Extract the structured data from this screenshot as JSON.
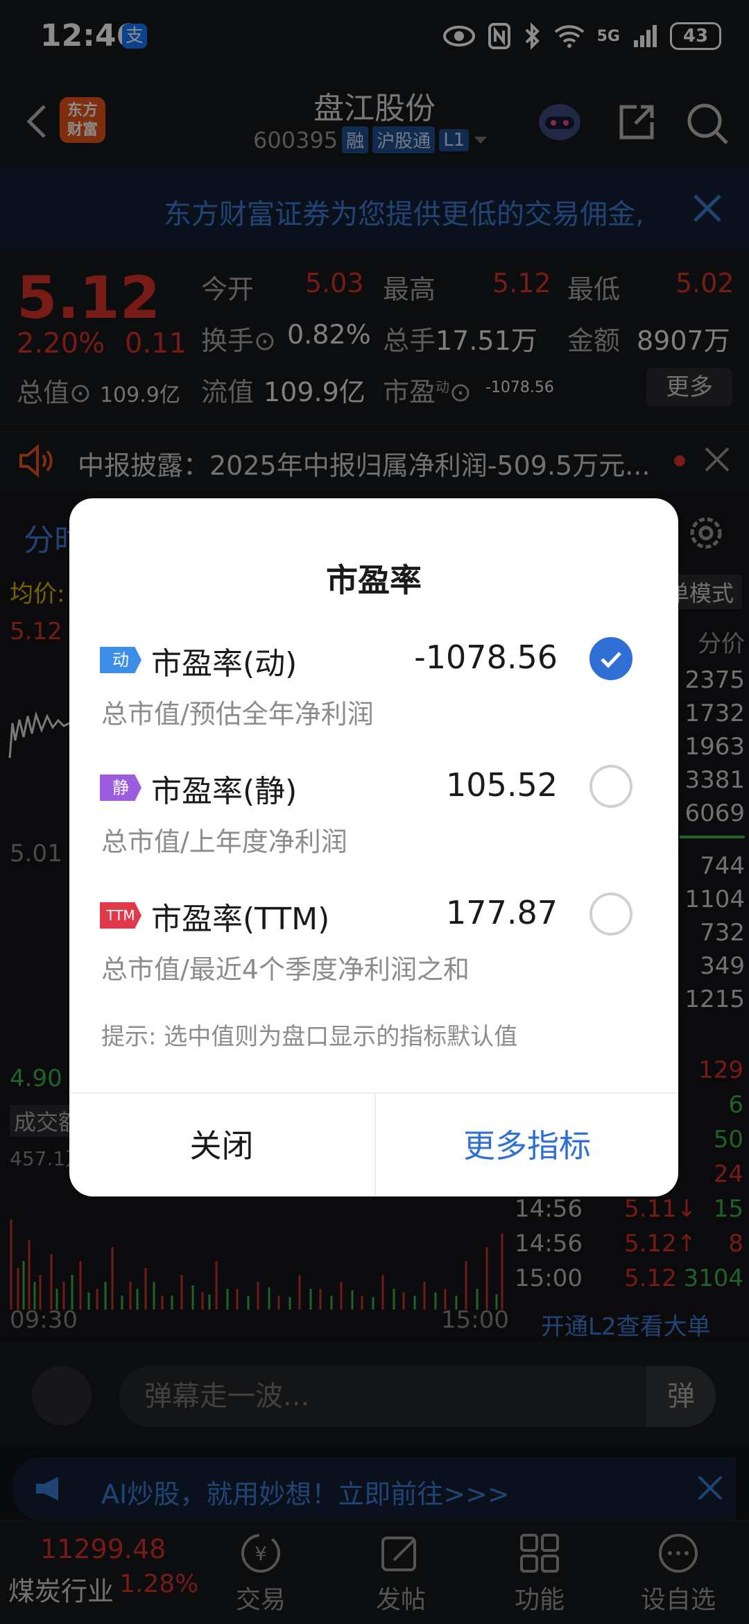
{
  "status_bar": {
    "time": "12:46",
    "alipay_icon": "支",
    "network": "5G",
    "battery": "43"
  },
  "header": {
    "stock_name": "盘江股份",
    "stock_code": "600395",
    "tags": [
      "融",
      "沪股通",
      "L1"
    ],
    "brand_logo": "东方\n财富"
  },
  "banner": {
    "text": "东方财富证券为您提供更低的交易佣金,"
  },
  "quote": {
    "price": "5.12",
    "change_pct": "2.20%",
    "change": "0.11",
    "total_value_label": "总值",
    "total_value": "109.9亿",
    "open_label": "今开",
    "open": "5.03",
    "high_label": "最高",
    "high": "5.12",
    "low_label": "最低",
    "low": "5.02",
    "turnover_label": "换手",
    "turnover": "0.82%",
    "volume_label": "总手",
    "volume": "17.51万",
    "amount_label": "金额",
    "amount": "8907万",
    "float_label": "流值",
    "float_value": "109.9亿",
    "pe_label": "市盈",
    "pe_sup": "动",
    "pe_value": "-1078.56",
    "more_button": "更多"
  },
  "announcement": {
    "text": "中报披露：2025年中报归属净利润-509.5万元..."
  },
  "chart_bg": {
    "tab": "分时",
    "avg_label": "均价:",
    "mode_label": "单模式",
    "top_price": "5.12",
    "mid_price": "5.01",
    "bottom_price": "4.90",
    "volume_label": "成交额",
    "volume_max": "457.1万",
    "time_start": "09:30",
    "time_end": "15:00",
    "side_header": "分价",
    "side_values": [
      "2375",
      "1732",
      "1963",
      "3381",
      "6069",
      "744",
      "1104",
      "732",
      "349",
      "1215"
    ],
    "ticks": [
      {
        "time": "",
        "price": "",
        "vol": "129"
      },
      {
        "time": "",
        "price": "",
        "vol": "6"
      },
      {
        "time": "",
        "price": "",
        "vol": "50"
      },
      {
        "time": "",
        "price": "",
        "vol": "24"
      },
      {
        "time": "14:56",
        "price": "5.11↓",
        "vol": "15"
      },
      {
        "time": "14:56",
        "price": "5.12↑",
        "vol": "8"
      },
      {
        "time": "15:00",
        "price": "5.12",
        "vol": "3104"
      }
    ],
    "l2_link": "开通L2查看大单"
  },
  "danmaku": {
    "placeholder": "弹幕走一波...",
    "send": "弹"
  },
  "ai_banner": {
    "text": "AI炒股，就用妙想！立即前往>>>"
  },
  "bottom_nav": {
    "index_value": "11299.48",
    "index_name": "煤炭行业",
    "index_pct": "1.28%",
    "items": [
      "交易",
      "发帖",
      "功能",
      "设自选"
    ]
  },
  "dialog": {
    "title": "市盈率",
    "options": [
      {
        "badge": "动",
        "badge_color": "#3d8ee8",
        "name": "市盈率(动)",
        "value": "-1078.56",
        "desc": "总市值/预估全年净利润",
        "checked": true
      },
      {
        "badge": "静",
        "badge_color": "#9b5ce0",
        "name": "市盈率(静)",
        "value": "105.52",
        "desc": "总市值/上年度净利润",
        "checked": false
      },
      {
        "badge": "TTM",
        "badge_color": "#e0394b",
        "name": "市盈率(TTM)",
        "value": "177.87",
        "desc": "总市值/最近4个季度净利润之和",
        "checked": false
      }
    ],
    "hint": "提示: 选中值则为盘口显示的指标默认值",
    "close_button": "关闭",
    "more_button": "更多指标"
  },
  "colors": {
    "up": "#d9322b",
    "down": "#3bb54a",
    "accent": "#2f6fd6"
  }
}
